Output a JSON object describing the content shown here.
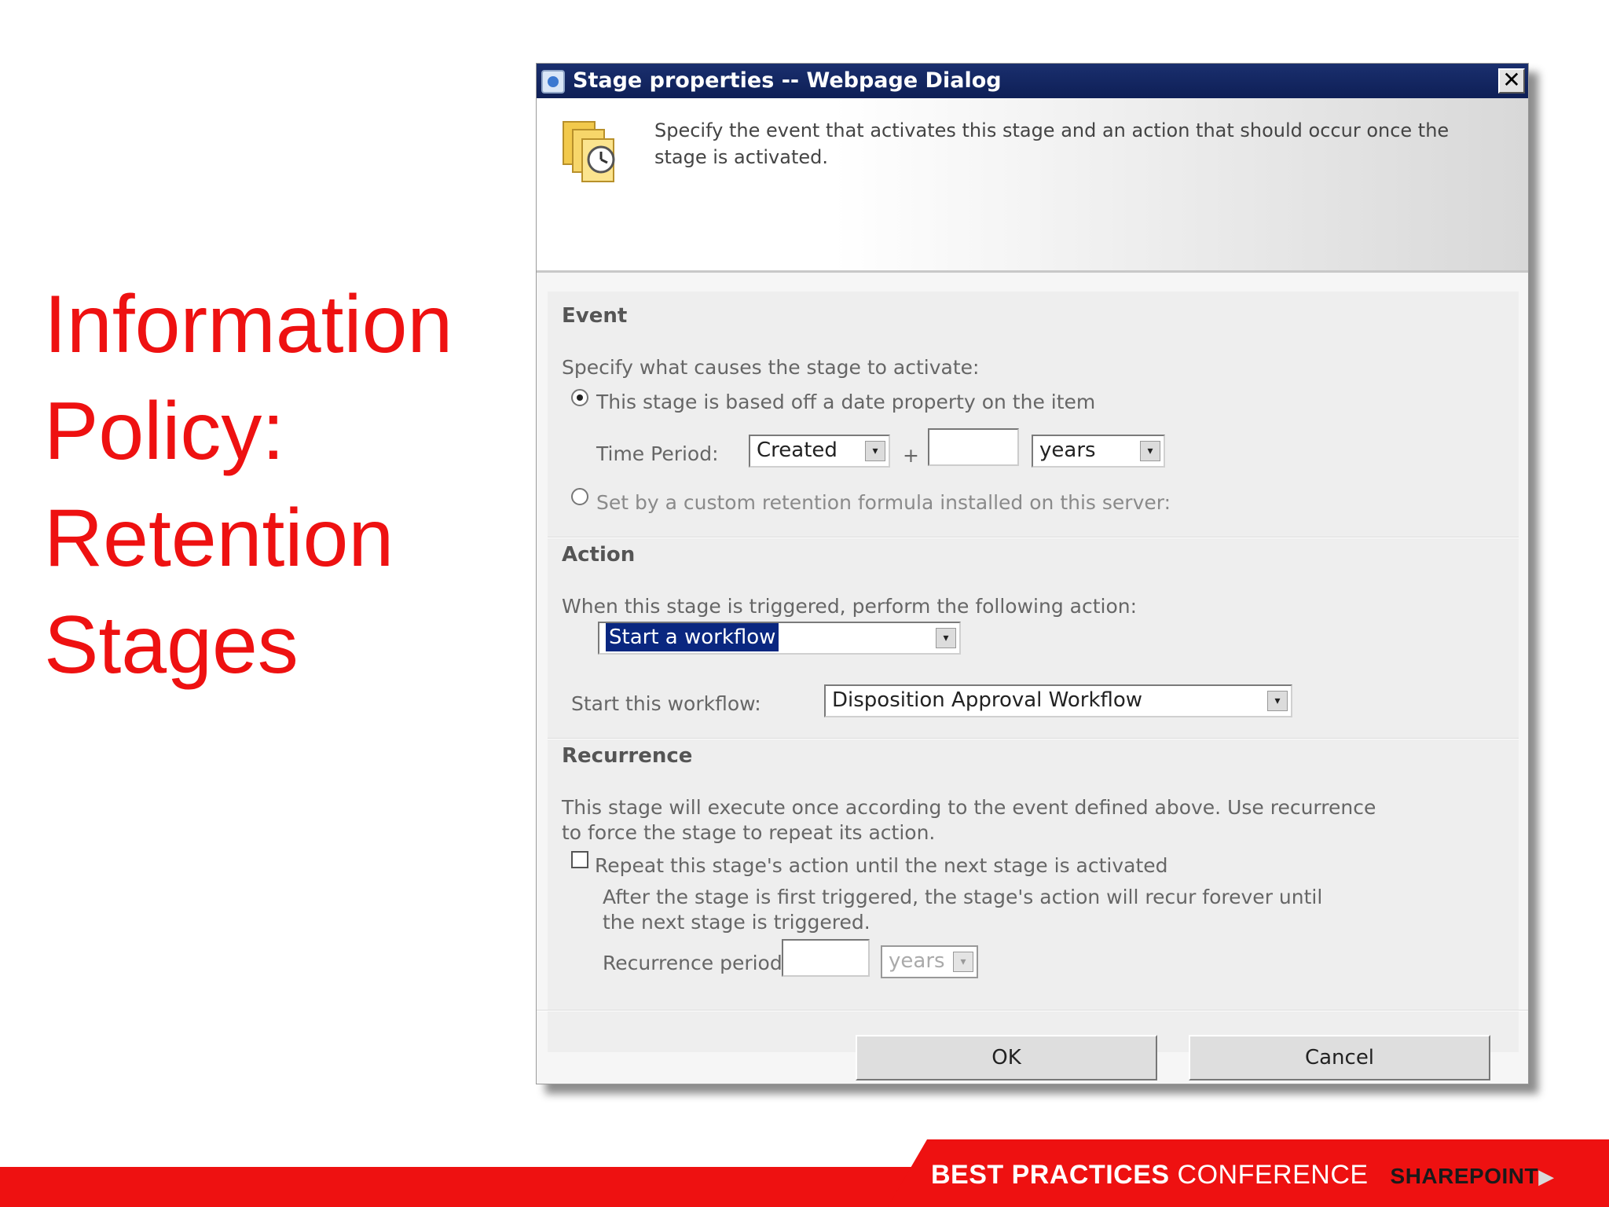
{
  "slide": {
    "title_lines": [
      "Information",
      "Policy:",
      "Retention",
      "Stages"
    ]
  },
  "dialog": {
    "title": "Stage properties -- Webpage Dialog",
    "close_glyph": "✕",
    "description": "Specify the event that activates this stage and an action that should occur once the stage is activated.",
    "event": {
      "heading": "Event",
      "instruction": "Specify what causes the stage to activate:",
      "option_date": "This stage is based off a date property on the item",
      "time_period_label": "Time Period:",
      "time_period_property": "Created",
      "plus": "+",
      "time_period_value": "",
      "time_period_unit": "years",
      "option_custom": "Set by a custom retention formula installed on this server:"
    },
    "action": {
      "heading": "Action",
      "instruction": "When this stage is triggered, perform the following action:",
      "selected_action": "Start a workflow",
      "workflow_label": "Start this workflow:",
      "selected_workflow": "Disposition Approval Workflow"
    },
    "recurrence": {
      "heading": "Recurrence",
      "description_line1": "This stage will execute once according to the event defined above. Use recurrence",
      "description_line2": "to force the stage to repeat its action.",
      "checkbox_label": "Repeat this stage's action until the next stage is activated",
      "note_line1": "After the stage is first triggered, the stage's action will recur forever until",
      "note_line2": "the next stage is triggered.",
      "period_label": "Recurrence period:",
      "period_value": "",
      "period_unit": "years"
    },
    "buttons": {
      "ok": "OK",
      "cancel": "Cancel"
    },
    "arrow_glyph": "▾"
  },
  "footer": {
    "best_practices": "BEST PRACTICES",
    "conference": "CONFERENCE",
    "brand": "SHAREPOINT",
    "arrow": "▶"
  },
  "colors": {
    "title_red": "#ee1111",
    "titlebar_navy": "#0e1f56",
    "selection_blue": "#0a2780"
  }
}
